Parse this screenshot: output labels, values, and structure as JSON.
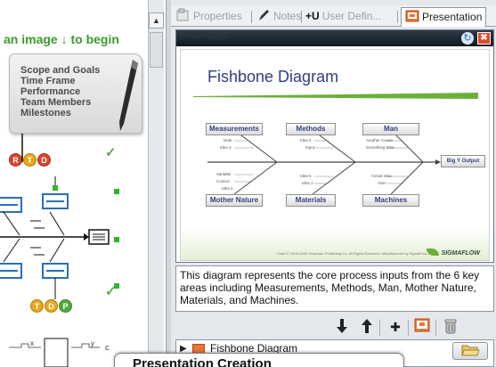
{
  "left_pane": {
    "begin_text": "an image ↓ to begin",
    "scroll_items": [
      "Scope and Goals",
      "Time Frame",
      "Performance",
      "Team Members",
      "Milestones"
    ],
    "status_bubbles": [
      {
        "letter": "R",
        "color": "#d8452a"
      },
      {
        "letter": "T",
        "color": "#e9a81c"
      },
      {
        "letter": "D",
        "color": "#d8452a"
      }
    ],
    "status_bubbles_2": [
      {
        "letter": "T",
        "color": "#e9a81c"
      },
      {
        "letter": "D",
        "color": "#e9a81c"
      },
      {
        "letter": "P",
        "color": "#4fae3a"
      }
    ],
    "flow_labels": {
      "x": "x",
      "y": "y",
      "c": "c"
    },
    "scroll_up_glyph": "▲"
  },
  "tabs": [
    {
      "label": "Properties",
      "icon": "properties-icon"
    },
    {
      "label": "Notes",
      "icon": "pencil-icon"
    },
    {
      "label": "User Defin...",
      "prefix": "+U",
      "icon": "user-defined-icon"
    },
    {
      "label": "Presentation",
      "icon": "presentation-icon",
      "active": true
    }
  ],
  "presentation": {
    "title": "Presentation",
    "refresh_glyph": "↻",
    "close_glyph": "✖",
    "slide": {
      "title": "Fishbone Diagram",
      "categories_top": [
        "Measurements",
        "Methods",
        "Man"
      ],
      "categories_bottom": [
        "Mother Nature",
        "Materials",
        "Machines"
      ],
      "effect": "Big Y Output",
      "tiny_labels": [
        "Note",
        "Idea 3",
        "Idea 4",
        "Input",
        "Another Cause",
        "Something Else",
        "Variable",
        "Control",
        "Idea 2",
        "Idea 5",
        "Idea 1",
        "Actual Idea",
        "Item"
      ],
      "copyright": "Chart © 2005-2006 Chapman Publishing Inc. All Rights Reserved. Manufactured by SigmaFlow Inc.",
      "logo": "SIGMAFLOW"
    },
    "description": "This diagram represents the core process inputs from the 6 key areas including Measurements, Methods, Man, Mother Nature, Materials, and Machines."
  },
  "toolbar": {
    "move_down": "🡫",
    "move_up": "🡩",
    "add": "✚",
    "present": "▣",
    "trash": "♲"
  },
  "tree": {
    "expand_glyph": "▶",
    "item_label": "Fishbone Diagram"
  },
  "bottom_label": "Presentation Creation",
  "colors": {
    "accent_green": "#3a9a2a",
    "slide_title_blue": "#2f3f7f",
    "orange": "#e8773a"
  }
}
